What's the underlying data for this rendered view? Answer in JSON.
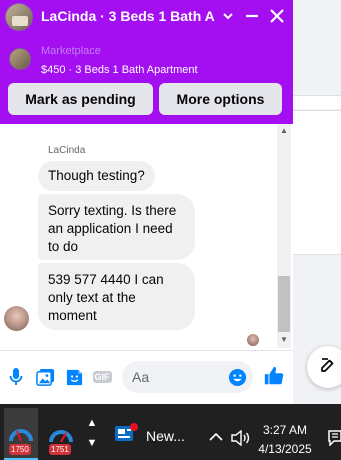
{
  "chat": {
    "title": "LaCinda · 3 Beds 1 Bath Ap",
    "listing": {
      "label": "Marketplace",
      "subtitle": "$450 · 3 Beds 1 Bath Apartment"
    },
    "actions": {
      "mark_pending": "Mark as pending",
      "more_options": "More options"
    },
    "messages": {
      "sender": "LaCinda",
      "items": [
        {
          "text": "Though testing?"
        },
        {
          "text": "Sorry texting. Is there an application I need to do"
        },
        {
          "text": "539 577 4440 I can only text at the moment"
        }
      ]
    },
    "composer": {
      "placeholder": "Aa",
      "gif_label": "GIF"
    }
  },
  "taskbar": {
    "apps": [
      {
        "name": "app-1",
        "badge": "1750"
      },
      {
        "name": "app-2",
        "badge": "1751"
      }
    ],
    "news_label": "New...",
    "time": "3:27 AM",
    "date": "4/13/2025"
  },
  "colors": {
    "header_bg": "#a30ff0",
    "accent_blue": "#0084ff",
    "bubble_bg": "#f0f0f0"
  }
}
